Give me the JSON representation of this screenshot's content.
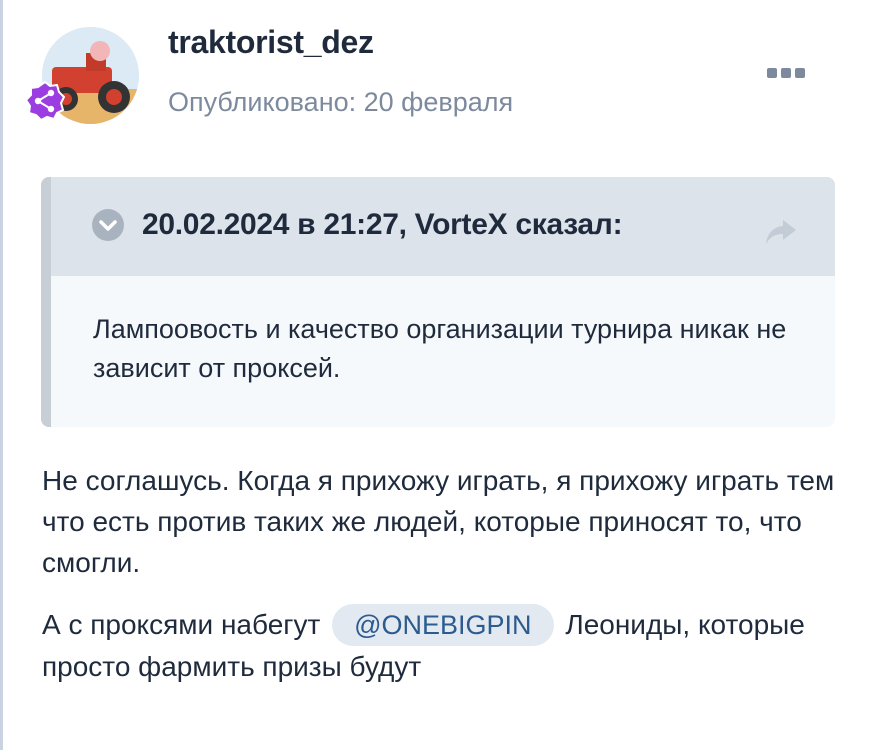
{
  "post": {
    "author": "traktorist_dez",
    "published": "Опубликовано: 20 февраля"
  },
  "quote": {
    "citation": "20.02.2024 в 21:27, VorteX сказал:",
    "text": "Лампоовость и качество организации турнира никак не зависит от проксей."
  },
  "content": {
    "p1": "Не соглашусь. Когда я прихожу играть, я прихожу играть тем что есть против таких же людей, которые приносят то, что смогли.",
    "p2_before": "А с проксями набегут",
    "mention": "@ONEBIGPIN",
    "p2_after": "Леониды, которые просто фармить призы будут"
  },
  "icons": {
    "role_badge": "share-nodes-icon",
    "more": "ellipsis-icon",
    "collapse": "chevron-down-circle-icon",
    "share": "share-arrow-icon"
  },
  "colors": {
    "author": "#1f2b3c",
    "date": "#7d8a9d",
    "badge": "#9b3de0",
    "mention_bg": "#e3e9f1",
    "mention_text": "#2c5b8f"
  }
}
